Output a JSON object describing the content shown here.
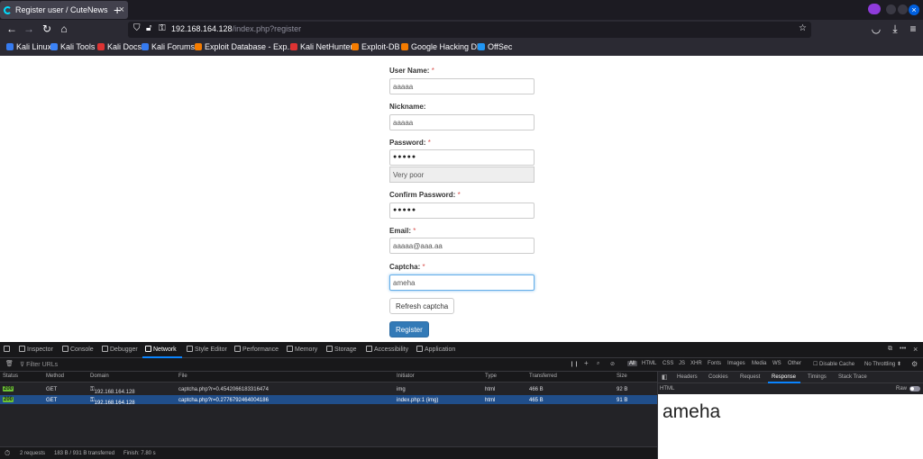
{
  "tab": {
    "title": "Register user / CuteNews"
  },
  "url": {
    "host": "192.168.164.128",
    "path": "/index.php?register"
  },
  "bookmarks": [
    {
      "label": "Kali Linux",
      "color": "#367bf0"
    },
    {
      "label": "Kali Tools",
      "color": "#3b82f6"
    },
    {
      "label": "Kali Docs",
      "color": "#d33"
    },
    {
      "label": "Kali Forums",
      "color": "#367bf0"
    },
    {
      "label": "Exploit Database - Exp...",
      "color": "#f57c00"
    },
    {
      "label": "Kali NetHunter",
      "color": "#d33"
    },
    {
      "label": "Exploit-DB",
      "color": "#f57c00"
    },
    {
      "label": "Google Hacking DB",
      "color": "#f57c00"
    },
    {
      "label": "OffSec",
      "color": "#2196f3"
    }
  ],
  "form": {
    "username_label": "User Name:",
    "username_value": "aaaaa",
    "nickname_label": "Nickname:",
    "nickname_value": "aaaaa",
    "password_label": "Password:",
    "password_value": "●●●●●",
    "strength_text": "Very poor",
    "confirm_label": "Confirm Password:",
    "confirm_value": "●●●●●",
    "email_label": "Email:",
    "email_value": "aaaaa@aaa.aa",
    "captcha_label": "Captcha:",
    "captcha_value": "ameha",
    "refresh_label": "Refresh captcha",
    "register_label": "Register",
    "required_mark": "*"
  },
  "devtools": {
    "tabs": [
      "Inspector",
      "Console",
      "Debugger",
      "Network",
      "Style Editor",
      "Performance",
      "Memory",
      "Storage",
      "Accessibility",
      "Application"
    ],
    "active_tab": "Network",
    "filter_placeholder": "Filter URLs",
    "filter_types": [
      "All",
      "HTML",
      "CSS",
      "JS",
      "XHR",
      "Fonts",
      "Images",
      "Media",
      "WS",
      "Other"
    ],
    "disable_cache": "Disable Cache",
    "throttling": "No Throttling ⬍",
    "columns": [
      "Status",
      "Method",
      "Domain",
      "File",
      "Initiator",
      "Type",
      "Transferred",
      "Size"
    ],
    "rows": [
      {
        "status": "200",
        "method": "GET",
        "domain": "192.168.164.128",
        "file": "captcha.php?r=0.4542066183316474",
        "initiator": "img",
        "type": "html",
        "transferred": "466 B",
        "size": "92 B"
      },
      {
        "status": "200",
        "method": "GET",
        "domain": "192.168.164.128",
        "file": "captcha.php?r=0.2776792464004186",
        "initiator": "index.php:1 (img)",
        "type": "html",
        "transferred": "465 B",
        "size": "91 B"
      }
    ],
    "status_bar": {
      "requests": "2 requests",
      "transferred": "183 B / 931 B transferred",
      "finish": "Finish: 7.80 s"
    },
    "side_tabs": [
      "Headers",
      "Cookies",
      "Request",
      "Response",
      "Timings",
      "Stack Trace"
    ],
    "side_active": "Response",
    "side_sub_label": "HTML",
    "raw_label": "Raw",
    "response_text": "ameha"
  }
}
